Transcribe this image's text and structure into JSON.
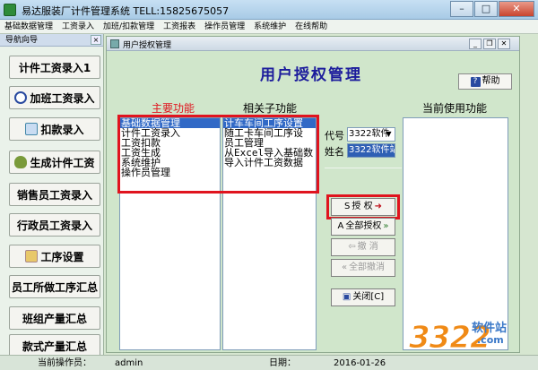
{
  "window": {
    "title": "易达服装厂计件管理系统  TELL:15825675057",
    "buttons": {
      "minimize": "–",
      "maximize": "□",
      "close": "✕"
    }
  },
  "menubar": [
    "基础数据管理",
    "工资录入",
    "加班/扣款管理",
    "工资报表",
    "操作员管理",
    "系统维护",
    "在线帮助"
  ],
  "nav": {
    "header": "导航向导",
    "pin": "×",
    "items": [
      {
        "label": "计件工资录入1",
        "icon": "none"
      },
      {
        "label": "加班工资录入",
        "icon": "clock-icon"
      },
      {
        "label": "扣款录入",
        "icon": "deduct-icon"
      },
      {
        "label": "生成计件工资",
        "icon": "money-bag-icon"
      },
      {
        "label": "销售员工资录入",
        "icon": "none"
      },
      {
        "label": "行政员工资录入",
        "icon": "none"
      },
      {
        "label": "工序设置",
        "icon": "settings-icon"
      },
      {
        "label": "员工所做工序汇总",
        "icon": "none"
      },
      {
        "label": "班组产量汇总",
        "icon": "none"
      },
      {
        "label": "款式产量汇总",
        "icon": "none"
      }
    ]
  },
  "child_window": {
    "title": "用户授权管理",
    "controls": {
      "minimize": "_",
      "restore": "❐",
      "close": "✕"
    }
  },
  "page": {
    "title": "用户授权管理",
    "help_button": "帮助",
    "main_func_header": "主要功能",
    "sub_func_header": "相关子功能",
    "current_func_header": "当前使用功能",
    "main_functions": [
      "基础数据管理",
      "计件工资录入",
      "工资扣款",
      "工资生成",
      "系统维护",
      "操作员管理"
    ],
    "main_selected_index": 0,
    "sub_functions": [
      "计车车间工序设置",
      "随工卡车间工序设",
      "员工管理",
      "从Excel导入基础数",
      "导入计件工资数据"
    ],
    "sub_selected_index": 0,
    "code_label": "代号",
    "code_value": "3322软件",
    "name_label": "姓名",
    "name_value": "3322软件站"
  },
  "actions": {
    "authorize": "授 权",
    "authorize_all": "全部授权",
    "revoke": "撤 消",
    "revoke_all": "全部撤消",
    "close": "关闭[C]",
    "authorize_key": "S",
    "authorize_all_key": "A",
    "close_key": "C"
  },
  "statusbar": {
    "operator_label": "当前操作员：",
    "operator_value": "admin",
    "date_label": "日期：",
    "date_value": "2016-01-26"
  },
  "watermark": {
    "number": "3322",
    "cn": "软件站",
    "domain": ".com"
  },
  "colors": {
    "title_blue": "#1c1c9c",
    "highlight_red": "#e0141e",
    "selection": "#3169c6",
    "background": "#d0e6cb"
  }
}
